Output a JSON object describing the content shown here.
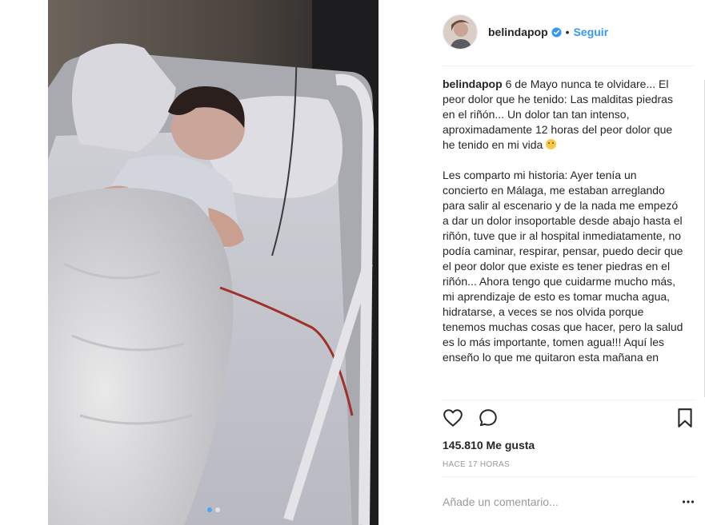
{
  "post": {
    "username": "belindapop",
    "verified_icon": "verified-badge-icon",
    "separator": "•",
    "follow_label": "Seguir",
    "caption_intro": "6 de Mayo nunca te olvidare... El peor dolor que he tenido: Las malditas piedras en el riñón... Un dolor tan tan intenso, aproximadamente 12 horas del peor dolor que he tenido en mi vida",
    "caption_body": "Les comparto mi historia: Ayer tenía un concierto en Málaga, me estaban arreglando para salir al escenario y de la nada me empezó a dar un dolor insoportable desde abajo hasta el riñón, tuve que ir al hospital inmediatamente, no podía caminar, respirar, pensar, puedo decir que el peor dolor que existe es tener piedras en el riñón... Ahora tengo que cuidarme mucho más, mi aprendizaje de esto es tomar mucha agua, hidratarse, a veces se nos olvida porque tenemos muchas cosas que hacer, pero la salud es lo más importante, tomen agua!!! Aquí les enseño lo que me quitaron esta mañana en",
    "likes": "145.810 Me gusta",
    "timestamp": "HACE 17 HORAS",
    "comment_placeholder": "Añade un comentario...",
    "carousel_position": 1,
    "carousel_count": 2
  },
  "colors": {
    "accent": "#3897f0",
    "verified": "#3897f0",
    "muted": "#999999",
    "text": "#262626"
  },
  "icons": {
    "like": "heart-icon",
    "comment": "comment-bubble-icon",
    "save": "bookmark-icon",
    "more": "more-dots-icon"
  }
}
